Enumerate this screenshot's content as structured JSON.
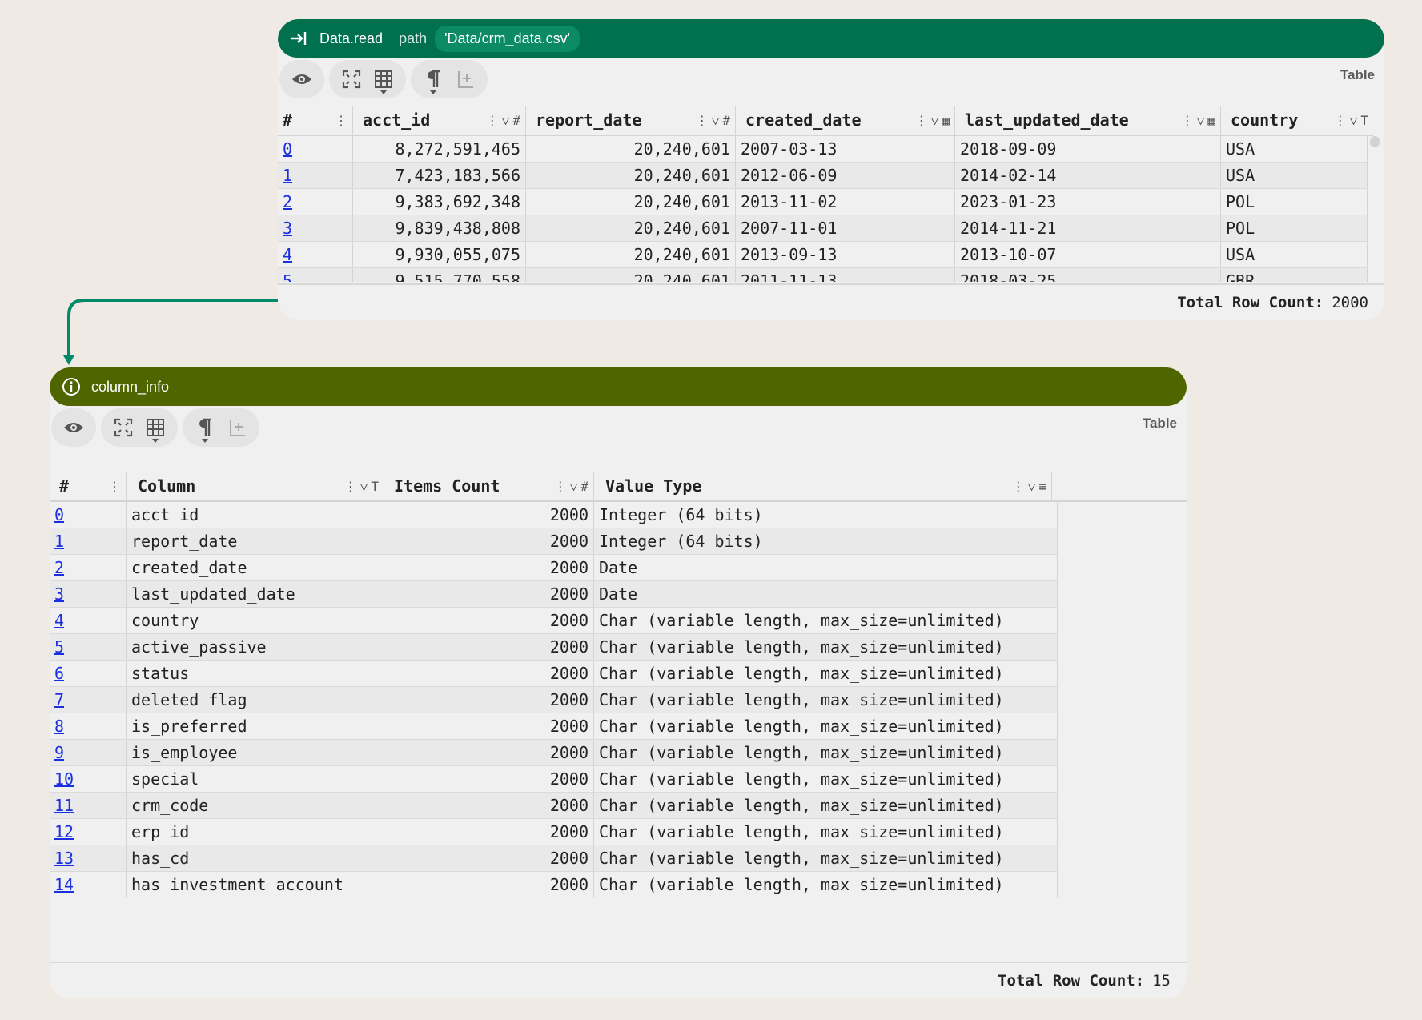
{
  "top_node": {
    "function": "Data.read",
    "param": "path",
    "value": "'Data/crm_data.csv'",
    "view_label": "Table",
    "columns": [
      {
        "name": "#"
      },
      {
        "name": "acct_id"
      },
      {
        "name": "report_date"
      },
      {
        "name": "created_date"
      },
      {
        "name": "last_updated_date"
      },
      {
        "name": "country"
      }
    ],
    "rows": [
      [
        "0",
        "8,272,591,465",
        "20,240,601",
        "2007-03-13",
        "2018-09-09",
        "USA"
      ],
      [
        "1",
        "7,423,183,566",
        "20,240,601",
        "2012-06-09",
        "2014-02-14",
        "USA"
      ],
      [
        "2",
        "9,383,692,348",
        "20,240,601",
        "2013-11-02",
        "2023-01-23",
        "POL"
      ],
      [
        "3",
        "9,839,438,808",
        "20,240,601",
        "2007-11-01",
        "2014-11-21",
        "POL"
      ],
      [
        "4",
        "9,930,055,075",
        "20,240,601",
        "2013-09-13",
        "2013-10-07",
        "USA"
      ],
      [
        "5",
        "9,515,770,558",
        "20,240,601",
        "2011-11-13",
        "2018-03-25",
        "GBR"
      ]
    ],
    "footer_label": "Total Row Count:",
    "footer_value": "2000"
  },
  "bottom_node": {
    "function": "column_info",
    "view_label": "Table",
    "columns": [
      {
        "name": "#"
      },
      {
        "name": "Column"
      },
      {
        "name": "Items Count"
      },
      {
        "name": "Value Type"
      }
    ],
    "rows": [
      [
        "0",
        "acct_id",
        "2000",
        "Integer (64 bits)"
      ],
      [
        "1",
        "report_date",
        "2000",
        "Integer (64 bits)"
      ],
      [
        "2",
        "created_date",
        "2000",
        "Date"
      ],
      [
        "3",
        "last_updated_date",
        "2000",
        "Date"
      ],
      [
        "4",
        "country",
        "2000",
        "Char (variable length, max_size=unlimited)"
      ],
      [
        "5",
        "active_passive",
        "2000",
        "Char (variable length, max_size=unlimited)"
      ],
      [
        "6",
        "status",
        "2000",
        "Char (variable length, max_size=unlimited)"
      ],
      [
        "7",
        "deleted_flag",
        "2000",
        "Char (variable length, max_size=unlimited)"
      ],
      [
        "8",
        "is_preferred",
        "2000",
        "Char (variable length, max_size=unlimited)"
      ],
      [
        "9",
        "is_employee",
        "2000",
        "Char (variable length, max_size=unlimited)"
      ],
      [
        "10",
        "special",
        "2000",
        "Char (variable length, max_size=unlimited)"
      ],
      [
        "11",
        "crm_code",
        "2000",
        "Char (variable length, max_size=unlimited)"
      ],
      [
        "12",
        "erp_id",
        "2000",
        "Char (variable length, max_size=unlimited)"
      ],
      [
        "13",
        "has_cd",
        "2000",
        "Char (variable length, max_size=unlimited)"
      ],
      [
        "14",
        "has_investment_account",
        "2000",
        "Char (variable length, max_size=unlimited)"
      ]
    ],
    "footer_label": "Total Row Count:",
    "footer_value": "15"
  },
  "colors": {
    "top_header": "#00704f",
    "bottom_header": "#4f6500",
    "connector": "#00896b",
    "link": "#1a2fe0"
  },
  "icons": [
    "input-arrow-icon",
    "info-icon",
    "eye-icon",
    "expand-icon",
    "table-grid-icon",
    "pilcrow-icon",
    "add-column-icon",
    "filter-icon",
    "kebab-menu-icon",
    "hash-type-icon",
    "date-type-icon",
    "text-type-icon",
    "sort-icon"
  ]
}
